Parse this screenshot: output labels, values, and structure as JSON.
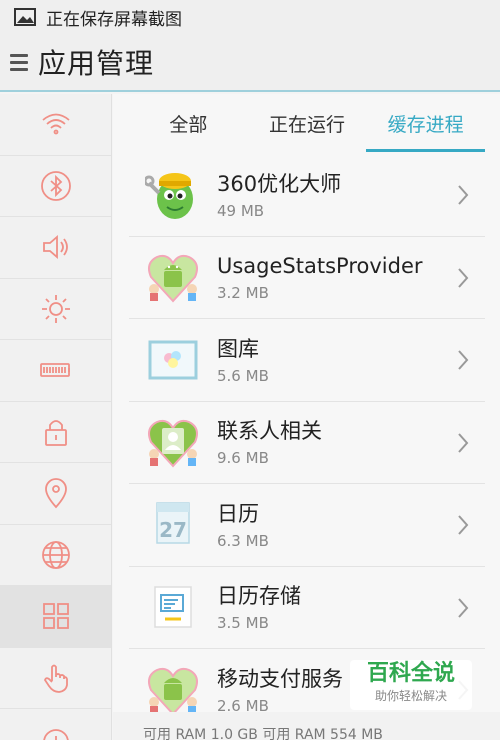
{
  "status_bar": {
    "text": "正在保存屏幕截图",
    "icon": "image-icon"
  },
  "header": {
    "title": "应用管理"
  },
  "sidebar": {
    "items": [
      {
        "icon": "wifi-icon"
      },
      {
        "icon": "bluetooth-icon"
      },
      {
        "icon": "volume-icon"
      },
      {
        "icon": "brightness-icon"
      },
      {
        "icon": "battery-icon"
      },
      {
        "icon": "lock-icon"
      },
      {
        "icon": "location-icon"
      },
      {
        "icon": "globe-icon"
      },
      {
        "icon": "apps-grid-icon"
      },
      {
        "icon": "hand-pointer-icon"
      },
      {
        "icon": "misc-icon"
      }
    ],
    "active_index": 8
  },
  "tabs": [
    {
      "label": "全部"
    },
    {
      "label": "正在运行"
    },
    {
      "label": "缓存进程"
    }
  ],
  "active_tab": 2,
  "apps": [
    {
      "name": "360优化大师",
      "size": "49 MB",
      "icon": "360-optimizer-icon"
    },
    {
      "name": "UsageStatsProvider",
      "size": "3.2 MB",
      "icon": "android-heart-icon"
    },
    {
      "name": "图库",
      "size": "5.6 MB",
      "icon": "gallery-icon"
    },
    {
      "name": "联系人相关",
      "size": "9.6 MB",
      "icon": "contacts-heart-icon"
    },
    {
      "name": "日历",
      "size": "6.3 MB",
      "icon": "calendar-icon"
    },
    {
      "name": "日历存储",
      "size": "3.5 MB",
      "icon": "calendar-storage-icon"
    },
    {
      "name": "移动支付服务",
      "size": "2.6 MB",
      "icon": "android-heart-icon"
    }
  ],
  "calendar_day": "27",
  "bottom_bar": {
    "text": "可用 RAM 1.0 GB    可用 RAM 554 MB"
  },
  "watermark": {
    "title": "百科全说",
    "subtitle": "助你轻松解决"
  },
  "colors": {
    "accent": "#36a9c4",
    "sidebar_icon": "#f08f86"
  }
}
